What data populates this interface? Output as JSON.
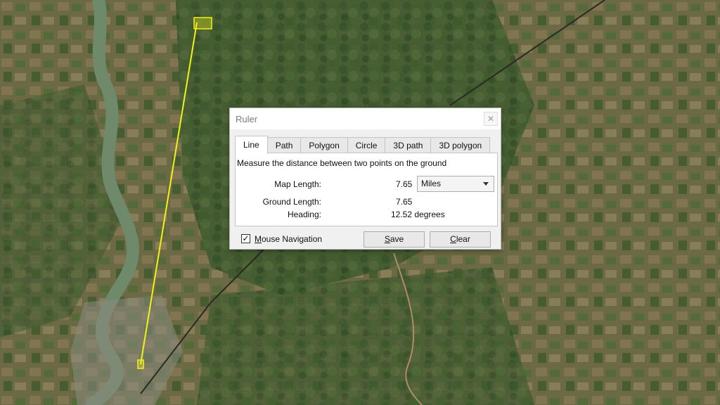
{
  "dialog": {
    "title": "Ruler",
    "close_glyph": "✕",
    "tabs": [
      {
        "label": "Line",
        "active": true
      },
      {
        "label": "Path",
        "active": false
      },
      {
        "label": "Polygon",
        "active": false
      },
      {
        "label": "Circle",
        "active": false
      },
      {
        "label": "3D path",
        "active": false
      },
      {
        "label": "3D polygon",
        "active": false
      }
    ],
    "description": "Measure the distance between two points on the ground",
    "map_length_label": "Map Length:",
    "map_length_value": "7.65",
    "units_selected": "Miles",
    "ground_length_label": "Ground Length:",
    "ground_length_value": "7.65",
    "heading_label": "Heading:",
    "heading_value": "12.52 degrees",
    "mouse_navigation_label": "Mouse Navigation",
    "mouse_navigation_checked": true,
    "check_glyph": "✓",
    "save_label": "Save",
    "clear_label": "Clear"
  },
  "colors": {
    "measure_line": "#f2f21a",
    "river": "#6f8a6a",
    "land_base": "#5a6a3e"
  },
  "icons": {
    "close": "close-icon",
    "dropdown": "chevron-down-icon",
    "checkbox": "checkmark-icon"
  }
}
